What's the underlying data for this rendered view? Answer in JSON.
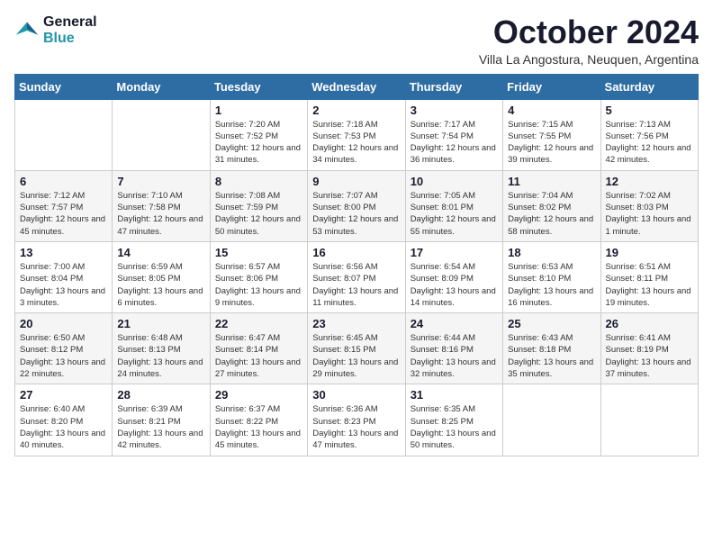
{
  "logo": {
    "line1": "General",
    "line2": "Blue"
  },
  "title": "October 2024",
  "subtitle": "Villa La Angostura, Neuquen, Argentina",
  "weekdays": [
    "Sunday",
    "Monday",
    "Tuesday",
    "Wednesday",
    "Thursday",
    "Friday",
    "Saturday"
  ],
  "weeks": [
    [
      {
        "day": "",
        "info": ""
      },
      {
        "day": "",
        "info": ""
      },
      {
        "day": "1",
        "info": "Sunrise: 7:20 AM\nSunset: 7:52 PM\nDaylight: 12 hours and 31 minutes."
      },
      {
        "day": "2",
        "info": "Sunrise: 7:18 AM\nSunset: 7:53 PM\nDaylight: 12 hours and 34 minutes."
      },
      {
        "day": "3",
        "info": "Sunrise: 7:17 AM\nSunset: 7:54 PM\nDaylight: 12 hours and 36 minutes."
      },
      {
        "day": "4",
        "info": "Sunrise: 7:15 AM\nSunset: 7:55 PM\nDaylight: 12 hours and 39 minutes."
      },
      {
        "day": "5",
        "info": "Sunrise: 7:13 AM\nSunset: 7:56 PM\nDaylight: 12 hours and 42 minutes."
      }
    ],
    [
      {
        "day": "6",
        "info": "Sunrise: 7:12 AM\nSunset: 7:57 PM\nDaylight: 12 hours and 45 minutes."
      },
      {
        "day": "7",
        "info": "Sunrise: 7:10 AM\nSunset: 7:58 PM\nDaylight: 12 hours and 47 minutes."
      },
      {
        "day": "8",
        "info": "Sunrise: 7:08 AM\nSunset: 7:59 PM\nDaylight: 12 hours and 50 minutes."
      },
      {
        "day": "9",
        "info": "Sunrise: 7:07 AM\nSunset: 8:00 PM\nDaylight: 12 hours and 53 minutes."
      },
      {
        "day": "10",
        "info": "Sunrise: 7:05 AM\nSunset: 8:01 PM\nDaylight: 12 hours and 55 minutes."
      },
      {
        "day": "11",
        "info": "Sunrise: 7:04 AM\nSunset: 8:02 PM\nDaylight: 12 hours and 58 minutes."
      },
      {
        "day": "12",
        "info": "Sunrise: 7:02 AM\nSunset: 8:03 PM\nDaylight: 13 hours and 1 minute."
      }
    ],
    [
      {
        "day": "13",
        "info": "Sunrise: 7:00 AM\nSunset: 8:04 PM\nDaylight: 13 hours and 3 minutes."
      },
      {
        "day": "14",
        "info": "Sunrise: 6:59 AM\nSunset: 8:05 PM\nDaylight: 13 hours and 6 minutes."
      },
      {
        "day": "15",
        "info": "Sunrise: 6:57 AM\nSunset: 8:06 PM\nDaylight: 13 hours and 9 minutes."
      },
      {
        "day": "16",
        "info": "Sunrise: 6:56 AM\nSunset: 8:07 PM\nDaylight: 13 hours and 11 minutes."
      },
      {
        "day": "17",
        "info": "Sunrise: 6:54 AM\nSunset: 8:09 PM\nDaylight: 13 hours and 14 minutes."
      },
      {
        "day": "18",
        "info": "Sunrise: 6:53 AM\nSunset: 8:10 PM\nDaylight: 13 hours and 16 minutes."
      },
      {
        "day": "19",
        "info": "Sunrise: 6:51 AM\nSunset: 8:11 PM\nDaylight: 13 hours and 19 minutes."
      }
    ],
    [
      {
        "day": "20",
        "info": "Sunrise: 6:50 AM\nSunset: 8:12 PM\nDaylight: 13 hours and 22 minutes."
      },
      {
        "day": "21",
        "info": "Sunrise: 6:48 AM\nSunset: 8:13 PM\nDaylight: 13 hours and 24 minutes."
      },
      {
        "day": "22",
        "info": "Sunrise: 6:47 AM\nSunset: 8:14 PM\nDaylight: 13 hours and 27 minutes."
      },
      {
        "day": "23",
        "info": "Sunrise: 6:45 AM\nSunset: 8:15 PM\nDaylight: 13 hours and 29 minutes."
      },
      {
        "day": "24",
        "info": "Sunrise: 6:44 AM\nSunset: 8:16 PM\nDaylight: 13 hours and 32 minutes."
      },
      {
        "day": "25",
        "info": "Sunrise: 6:43 AM\nSunset: 8:18 PM\nDaylight: 13 hours and 35 minutes."
      },
      {
        "day": "26",
        "info": "Sunrise: 6:41 AM\nSunset: 8:19 PM\nDaylight: 13 hours and 37 minutes."
      }
    ],
    [
      {
        "day": "27",
        "info": "Sunrise: 6:40 AM\nSunset: 8:20 PM\nDaylight: 13 hours and 40 minutes."
      },
      {
        "day": "28",
        "info": "Sunrise: 6:39 AM\nSunset: 8:21 PM\nDaylight: 13 hours and 42 minutes."
      },
      {
        "day": "29",
        "info": "Sunrise: 6:37 AM\nSunset: 8:22 PM\nDaylight: 13 hours and 45 minutes."
      },
      {
        "day": "30",
        "info": "Sunrise: 6:36 AM\nSunset: 8:23 PM\nDaylight: 13 hours and 47 minutes."
      },
      {
        "day": "31",
        "info": "Sunrise: 6:35 AM\nSunset: 8:25 PM\nDaylight: 13 hours and 50 minutes."
      },
      {
        "day": "",
        "info": ""
      },
      {
        "day": "",
        "info": ""
      }
    ]
  ]
}
